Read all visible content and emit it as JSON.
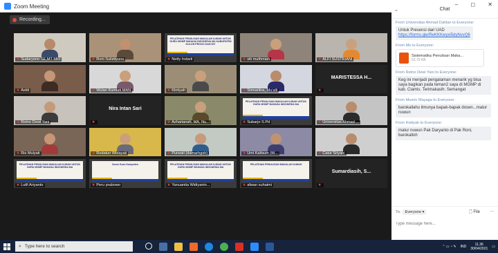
{
  "window": {
    "title": "Zoom Meeting",
    "controls": "–  ◻  ✕"
  },
  "recording": {
    "label": "Recording..."
  },
  "tiles": [
    {
      "name": "Sudaryono SE,MT MKI",
      "kind": "video",
      "bg": "#cfcac0",
      "skin": "#b88a6a",
      "shirt": "#3a4b6a"
    },
    {
      "name": "Roni Sulistiyono",
      "kind": "video",
      "bg": "#a99277",
      "skin": "#c09070",
      "shirt": "#5a4a3a"
    },
    {
      "name": "Netty Indarti",
      "kind": "slide",
      "slide": "PELATIHAN PENULISAN MAKALAH ILMIAH UNTUK GURU MGMP BAHASA INDONESIA MA KABUPATEN KULON PROGO DAN DIY"
    },
    {
      "name": "siti muthmiah",
      "kind": "video",
      "bg": "#8f8479",
      "skin": "#c9a07a",
      "shirt": "#b73548"
    },
    {
      "name": "ALFI SUSTRIANI",
      "kind": "video",
      "bg": "#b9b4ae",
      "skin": "#c8a27e",
      "shirt": "#e28a32"
    },
    {
      "name": "Astiti",
      "kind": "video",
      "bg": "#7a5c4a",
      "skin": "#c69676",
      "shirt": "#3d2b24"
    },
    {
      "name": "Wulan Kumiati MAN",
      "kind": "video",
      "bg": "#d8d8d8",
      "skin": "#c9a07a",
      "shirt": "#7a5a6a"
    },
    {
      "name": "Klotiyah",
      "kind": "video",
      "bg": "#9c8e76",
      "skin": "#caa07c",
      "shirt": "#4a4a4a"
    },
    {
      "name": "Srimarlina_Mu'alli",
      "kind": "video",
      "bg": "#d4d6e0",
      "skin": "#b98c6c",
      "shirt": "#2a2a6a"
    },
    {
      "name": "MARISTESSA H...",
      "kind": "name"
    },
    {
      "name": "Retno Dewi Yani",
      "kind": "video",
      "bg": "#c7c2bb",
      "skin": "#c49a78",
      "shirt": "#3b3b3b"
    },
    {
      "name": "Nira Intan Sari",
      "kind": "name"
    },
    {
      "name": "Azharianah, MA, Nu...",
      "kind": "video",
      "bg": "#8a8a6a",
      "skin": "#c8a07c",
      "shirt": "#5a4a2a",
      "highlight": true
    },
    {
      "name": "Subarjo S.Pd",
      "kind": "slide",
      "slide": "PELATIHAN PENULISAN MAKALAH ILMIAH UNTUK GURU MGMP BAHASA INDONESIA MA"
    },
    {
      "name": "Universitas Ahmad ...",
      "kind": "video",
      "bg": "#c4c4c4",
      "skin": "#b98c6c",
      "shirt": "#2b2b2b"
    },
    {
      "name": "Ris Mulyati",
      "kind": "video",
      "bg": "#7a6656",
      "skin": "#c69676",
      "shirt": "#a33a3a"
    },
    {
      "name": "Rodatun Widayati",
      "kind": "video",
      "bg": "#d8b84a",
      "skin": "#c9a07a",
      "shirt": "#6a6a7a"
    },
    {
      "name": "Purwati (damarhgsh)",
      "kind": "video",
      "bg": "#c3c9c3",
      "skin": "#c69a7a",
      "shirt": "#2e5e8e"
    },
    {
      "name": "Umi Kaltsum (M...",
      "kind": "video",
      "bg": "#8d8aa6",
      "skin": "#c19272",
      "shirt": "#3e3e6e"
    },
    {
      "name": "Catur Sriyani",
      "kind": "video",
      "bg": "#cfcfcf",
      "skin": "#b98c6c",
      "shirt": "#2a2a2a"
    },
    {
      "name": "Lutfi Ariyanto",
      "kind": "slide",
      "slide": "PELATIHAN PENULISAN MAKALAH ILMIAH UNTUK GURU MGMP BAHASA INDONESIA MA"
    },
    {
      "name": "Peru prabowo",
      "kind": "slide",
      "slide": "Zoom Guru Kompeten"
    },
    {
      "name": "Yanuanita Widiyanin...",
      "kind": "slide",
      "slide": "PELATIHAN PENULISAN MAKALAH ILMIAH UNTUK GURU MGMP BAHASA INDONESIA MA"
    },
    {
      "name": "afwan suhaimi",
      "kind": "slide",
      "slide": "PELATIHAN PENULISAN MAKALAH ILMIAH"
    },
    {
      "name": "Sumardiasih, S...",
      "kind": "name"
    }
  ],
  "chat": {
    "title": "Chat",
    "messages": [
      {
        "from": "From Universitas Ahmad Dahlan to Everyone:",
        "text": "Untuk Presensi dari UAD",
        "link": "https://forms.gle/ReKKKwyxi5dyNvvQ6"
      },
      {
        "from": "From Me to Everyone:",
        "file": {
          "name": "Sistematika Penulisan Maka...",
          "size": "52,70 KB"
        }
      },
      {
        "from": "From Retno Dewi Yani to Everyone:",
        "text": "Keg ini menjadi pengalaman menarik yg bisa saya bagikan pada teman2 saya di MGMP di kab. Ciamis. Terimakasih. Semangat"
      },
      {
        "from": "From Musrin Mayaga to Everyone:",
        "text": "barokallahu ilmunya bapak-bapak dosen...matur nuwun"
      },
      {
        "from": "From Kistiyah to Everyone:",
        "text": "matur nuwun Pak Daryanto di Pak Roni, barokalloh"
      }
    ],
    "to_label": "To:",
    "recipient": "Everyone",
    "file_button": "File",
    "more": "...",
    "placeholder": "Type message here..."
  },
  "taskbar": {
    "search_placeholder": "Type here to search",
    "lang": "IND",
    "time": "11.36",
    "date": "30/04/2021"
  },
  "colors": {
    "accent": "#2d8cff",
    "mic_muted": "#e5413a",
    "active_speaker": "#c9d63a"
  }
}
